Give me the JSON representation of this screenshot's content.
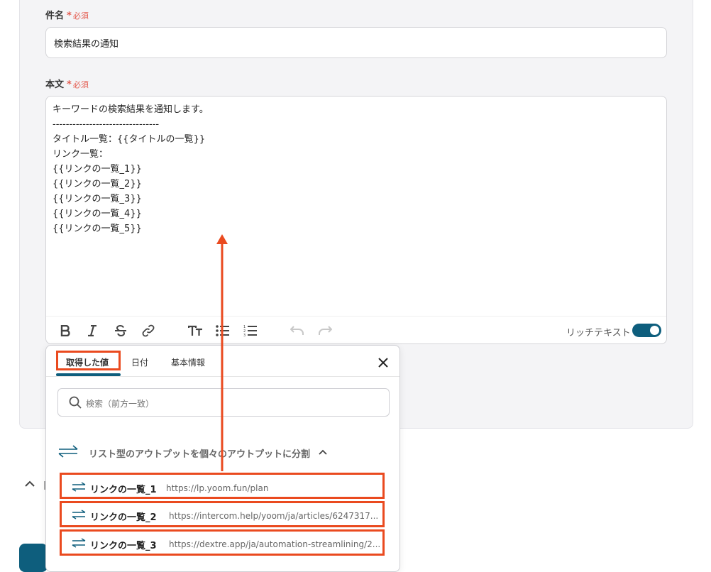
{
  "subject": {
    "label": "件名",
    "required_mark": "*",
    "required_text": "必須",
    "value": "検索結果の通知"
  },
  "body": {
    "label": "本文",
    "required_mark": "*",
    "required_text": "必須",
    "value": "キーワードの検索結果を通知します。\n--------------------------------\nタイトル一覧：{{タイトルの一覧}}\nリンク一覧：\n{{リンクの一覧_1}}\n{{リンクの一覧_2}}\n{{リンクの一覧_3}}\n{{リンクの一覧_4}}\n{{リンクの一覧_5}}"
  },
  "toolbar": {
    "buttons": [
      "bold-icon",
      "italic-icon",
      "strikethrough-icon",
      "link-icon",
      "text-size-icon",
      "bullet-list-icon",
      "numbered-list-icon",
      "undo-icon",
      "redo-icon"
    ],
    "rich_text_label": "リッチテキスト",
    "rich_text_on": true
  },
  "picker": {
    "tabs": [
      {
        "label": "取得した値",
        "active": true
      },
      {
        "label": "日付",
        "active": false
      },
      {
        "label": "基本情報",
        "active": false
      }
    ],
    "search_placeholder": "検索（前方一致）",
    "group_label": "リスト型のアウトプットを個々のアウトプットに分割",
    "items": [
      {
        "name": "リンクの一覧_1",
        "url": "https://lp.yoom.fun/plan"
      },
      {
        "name": "リンクの一覧_2",
        "url": "https://intercom.help/yoom/ja/articles/6247317..."
      },
      {
        "name": "リンクの一覧_3",
        "url": "https://dextre.app/ja/automation-streamlining/2..."
      }
    ]
  },
  "colors": {
    "accent": "#0e5e7d",
    "required": "#e45b4f",
    "highlight": "#ea4a1f"
  }
}
